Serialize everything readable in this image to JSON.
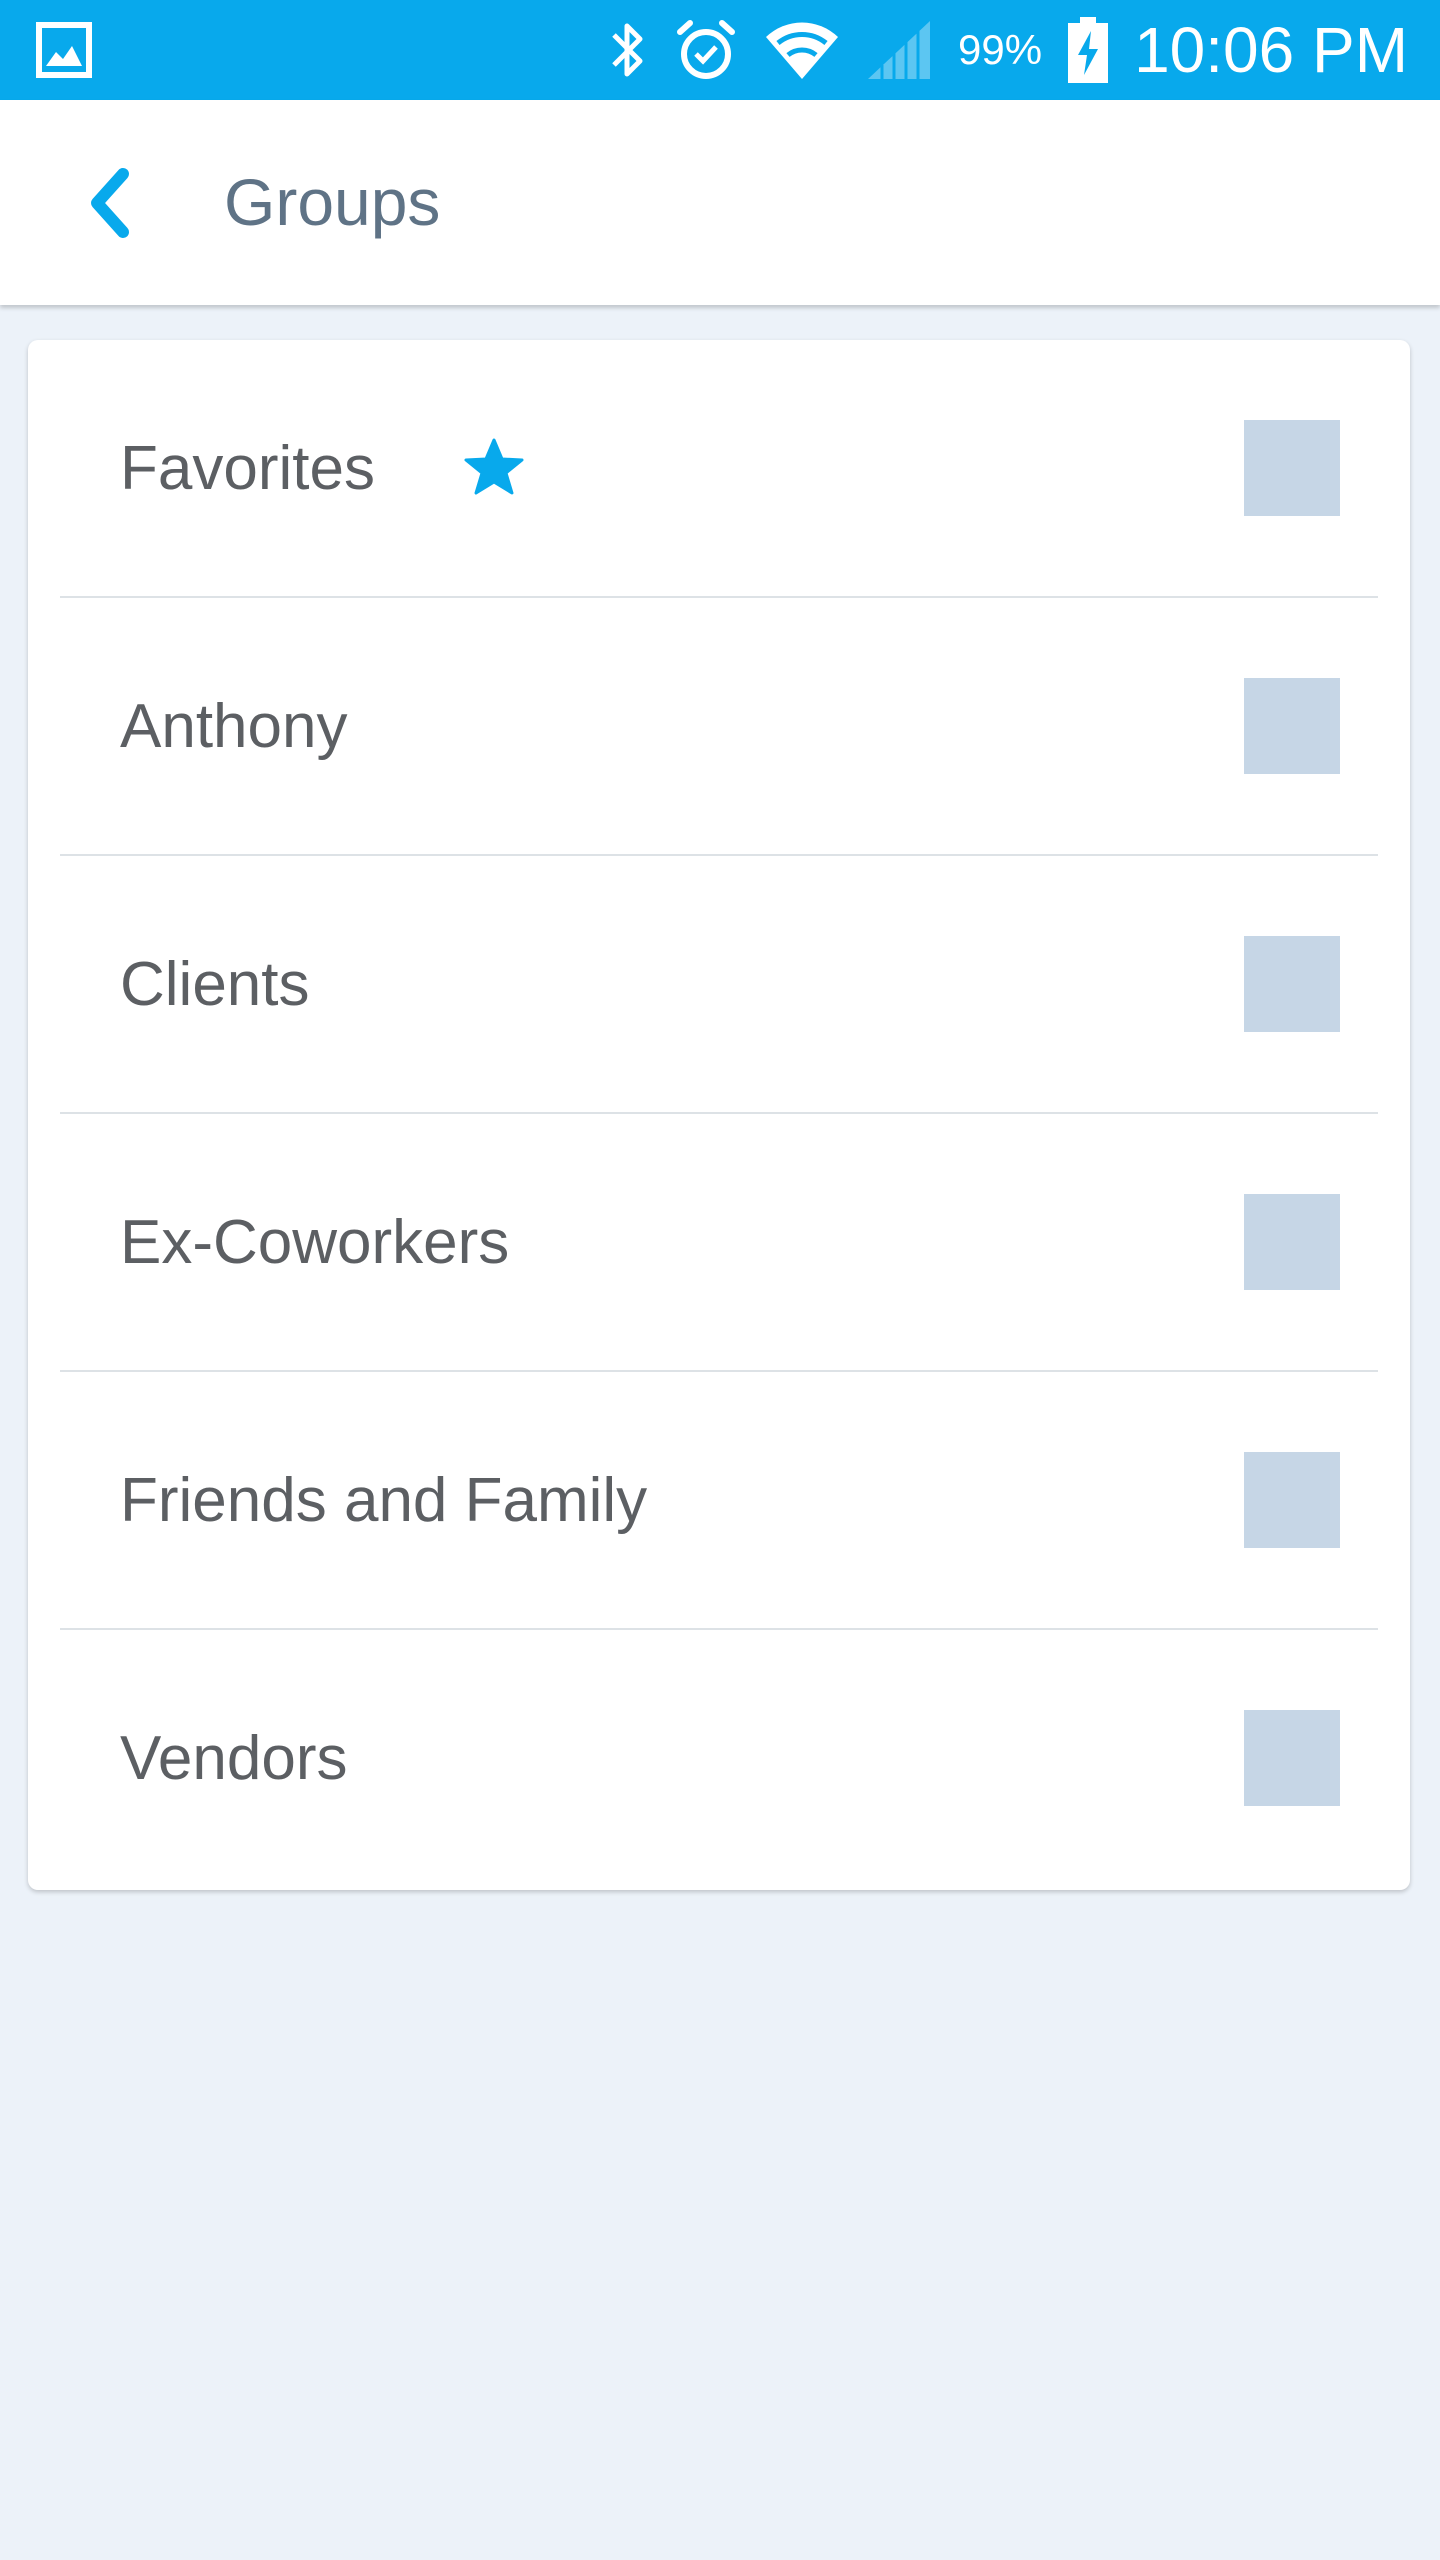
{
  "status_bar": {
    "battery_percent": "99%",
    "time": "10:06 PM",
    "icons": [
      "gallery-icon",
      "bluetooth-icon",
      "alarm-icon",
      "wifi-icon",
      "signal-icon",
      "battery-charging-icon"
    ]
  },
  "app_bar": {
    "title": "Groups",
    "back_icon": "chevron-left-icon"
  },
  "groups": [
    {
      "label": "Favorites",
      "starred": true,
      "checked": false
    },
    {
      "label": "Anthony",
      "starred": false,
      "checked": false
    },
    {
      "label": "Clients",
      "starred": false,
      "checked": false
    },
    {
      "label": "Ex-Coworkers",
      "starred": false,
      "checked": false
    },
    {
      "label": "Friends and Family",
      "starred": false,
      "checked": false
    },
    {
      "label": "Vendors",
      "starred": false,
      "checked": false
    }
  ],
  "colors": {
    "status_bar": "#08a9ec",
    "accent": "#08a9ec",
    "background": "#ecf2f9",
    "title_text": "#5f7386",
    "item_text": "#5c5f63",
    "checkbox_fill": "#c6d6e6"
  }
}
